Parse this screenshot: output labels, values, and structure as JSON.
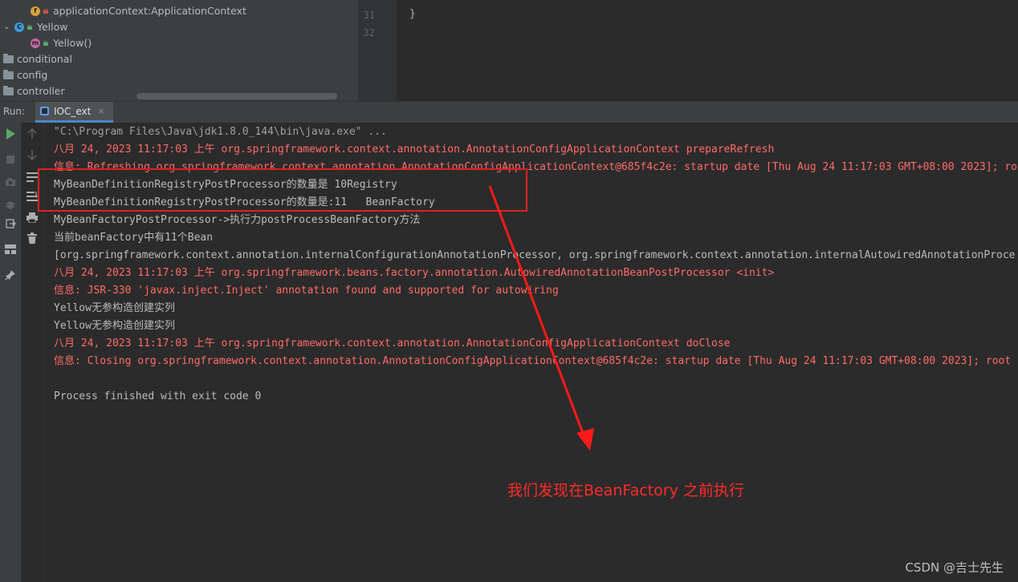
{
  "project_tree": {
    "items": [
      {
        "label": "applicationContext:ApplicationContext",
        "kind": "field"
      },
      {
        "label": "Yellow",
        "kind": "class"
      },
      {
        "label": "Yellow()",
        "kind": "method"
      },
      {
        "label": "conditional",
        "kind": "folder"
      },
      {
        "label": "config",
        "kind": "folder"
      },
      {
        "label": "controller",
        "kind": "folder"
      }
    ],
    "badges": {
      "field": "f",
      "class": "C",
      "method": "m"
    }
  },
  "editor": {
    "line_numbers": [
      "31",
      "32"
    ],
    "code_lines": [
      "}"
    ]
  },
  "run_window": {
    "label": "Run:",
    "tab_label": "IOC_ext",
    "tab_close": "×"
  },
  "console": {
    "lines": [
      {
        "text": "\"C:\\Program Files\\Java\\jdk1.8.0_144\\bin\\java.exe\" ...",
        "style": "dim"
      },
      {
        "text": "八月 24, 2023 11:17:03 上午 org.springframework.context.annotation.AnnotationConfigApplicationContext prepareRefresh",
        "style": "red"
      },
      {
        "text": "信息: Refreshing org.springframework.context.annotation.AnnotationConfigApplicationContext@685f4c2e: startup date [Thu Aug 24 11:17:03 GMT+08:00 2023]; root",
        "style": "red"
      },
      {
        "text": "MyBeanDefinitionRegistryPostProcessor的数量是 10Registry",
        "style": "grey"
      },
      {
        "text": "MyBeanDefinitionRegistryPostProcessor的数量是:11   BeanFactory",
        "style": "grey"
      },
      {
        "text": "MyBeanFactoryPostProcessor->执行力postProcessBeanFactory方法",
        "style": "grey"
      },
      {
        "text": "当前beanFactory中有11个Bean",
        "style": "grey"
      },
      {
        "text": "[org.springframework.context.annotation.internalConfigurationAnnotationProcessor, org.springframework.context.annotation.internalAutowiredAnnotationProce",
        "style": "grey"
      },
      {
        "text": "八月 24, 2023 11:17:03 上午 org.springframework.beans.factory.annotation.AutowiredAnnotationBeanPostProcessor <init>",
        "style": "red"
      },
      {
        "text": "信息: JSR-330 'javax.inject.Inject' annotation found and supported for autowiring",
        "style": "red"
      },
      {
        "text": "Yellow无参构造创建实列",
        "style": "grey"
      },
      {
        "text": "Yellow无参构造创建实列",
        "style": "grey"
      },
      {
        "text": "八月 24, 2023 11:17:03 上午 org.springframework.context.annotation.AnnotationConfigApplicationContext doClose",
        "style": "red"
      },
      {
        "text": "信息: Closing org.springframework.context.annotation.AnnotationConfigApplicationContext@685f4c2e: startup date [Thu Aug 24 11:17:03 GMT+08:00 2023]; root",
        "style": "red"
      },
      {
        "text": "",
        "style": "grey"
      },
      {
        "text": "Process finished with exit code 0",
        "style": "grey"
      }
    ]
  },
  "annotation": {
    "text": "我们发现在BeanFactory 之前执行",
    "color": "#ff2a2a"
  },
  "watermark": "CSDN @吉士先生",
  "colors": {
    "error_text": "#ff6b68",
    "normal_text": "#bbbbbb",
    "run_icon": "#59a869",
    "accent": "#4a88c7"
  }
}
